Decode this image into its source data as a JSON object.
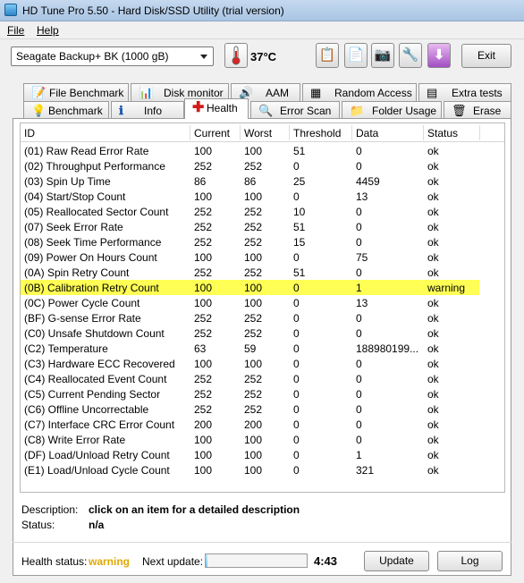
{
  "window": {
    "title": "HD Tune Pro 5.50 - Hard Disk/SSD Utility (trial version)"
  },
  "menu": {
    "file": "File",
    "help": "Help"
  },
  "toolbar": {
    "drive": "Seagate Backup+ BK (1000 gB)",
    "temperature": "37°C",
    "exit_label": "Exit"
  },
  "tabs_row1": [
    {
      "label": "File Benchmark",
      "icon": "file-benchmark-icon"
    },
    {
      "label": "Disk monitor",
      "icon": "disk-monitor-icon"
    },
    {
      "label": "AAM",
      "icon": "speaker-icon"
    },
    {
      "label": "Random Access",
      "icon": "random-access-icon"
    },
    {
      "label": "Extra tests",
      "icon": "extra-tests-icon"
    }
  ],
  "tabs_row2": [
    {
      "label": "Benchmark",
      "icon": "lightbulb-icon"
    },
    {
      "label": "Info",
      "icon": "info-icon"
    },
    {
      "label": "Health",
      "icon": "health-cross-icon"
    },
    {
      "label": "Error Scan",
      "icon": "magnifier-icon"
    },
    {
      "label": "Folder Usage",
      "icon": "folder-icon"
    },
    {
      "label": "Erase",
      "icon": "trash-icon"
    }
  ],
  "table": {
    "headers": [
      "ID",
      "Current",
      "Worst",
      "Threshold",
      "Data",
      "Status"
    ],
    "highlight_color": "#ffff55",
    "rows": [
      [
        "(01) Raw Read Error Rate",
        "100",
        "100",
        "51",
        "0",
        "ok"
      ],
      [
        "(02) Throughput Performance",
        "252",
        "252",
        "0",
        "0",
        "ok"
      ],
      [
        "(03) Spin Up Time",
        "86",
        "86",
        "25",
        "4459",
        "ok"
      ],
      [
        "(04) Start/Stop Count",
        "100",
        "100",
        "0",
        "13",
        "ok"
      ],
      [
        "(05) Reallocated Sector Count",
        "252",
        "252",
        "10",
        "0",
        "ok"
      ],
      [
        "(07) Seek Error Rate",
        "252",
        "252",
        "51",
        "0",
        "ok"
      ],
      [
        "(08) Seek Time Performance",
        "252",
        "252",
        "15",
        "0",
        "ok"
      ],
      [
        "(09) Power On Hours Count",
        "100",
        "100",
        "0",
        "75",
        "ok"
      ],
      [
        "(0A) Spin Retry Count",
        "252",
        "252",
        "51",
        "0",
        "ok"
      ],
      [
        "(0B) Calibration Retry Count",
        "100",
        "100",
        "0",
        "1",
        "warning"
      ],
      [
        "(0C) Power Cycle Count",
        "100",
        "100",
        "0",
        "13",
        "ok"
      ],
      [
        "(BF) G-sense Error Rate",
        "252",
        "252",
        "0",
        "0",
        "ok"
      ],
      [
        "(C0) Unsafe Shutdown Count",
        "252",
        "252",
        "0",
        "0",
        "ok"
      ],
      [
        "(C2) Temperature",
        "63",
        "59",
        "0",
        "188980199...",
        "ok"
      ],
      [
        "(C3) Hardware ECC Recovered",
        "100",
        "100",
        "0",
        "0",
        "ok"
      ],
      [
        "(C4) Reallocated Event Count",
        "252",
        "252",
        "0",
        "0",
        "ok"
      ],
      [
        "(C5) Current Pending Sector",
        "252",
        "252",
        "0",
        "0",
        "ok"
      ],
      [
        "(C6) Offline Uncorrectable",
        "252",
        "252",
        "0",
        "0",
        "ok"
      ],
      [
        "(C7) Interface CRC Error Count",
        "200",
        "200",
        "0",
        "0",
        "ok"
      ],
      [
        "(C8) Write Error Rate",
        "100",
        "100",
        "0",
        "0",
        "ok"
      ],
      [
        "(DF) Load/Unload Retry Count",
        "100",
        "100",
        "0",
        "1",
        "ok"
      ],
      [
        "(E1) Load/Unload Cycle Count",
        "100",
        "100",
        "0",
        "321",
        "ok"
      ]
    ]
  },
  "details": {
    "description_label": "Description:",
    "description_value": "click on an item for a detailed description",
    "status_label": "Status:",
    "status_value": "n/a"
  },
  "footer": {
    "health_label": "Health status:",
    "health_value": "warning",
    "health_color": "#e0a800",
    "next_update_label": "Next update:",
    "countdown": "4:43",
    "update_progress": 0.02,
    "update_label": "Update",
    "log_label": "Log"
  }
}
